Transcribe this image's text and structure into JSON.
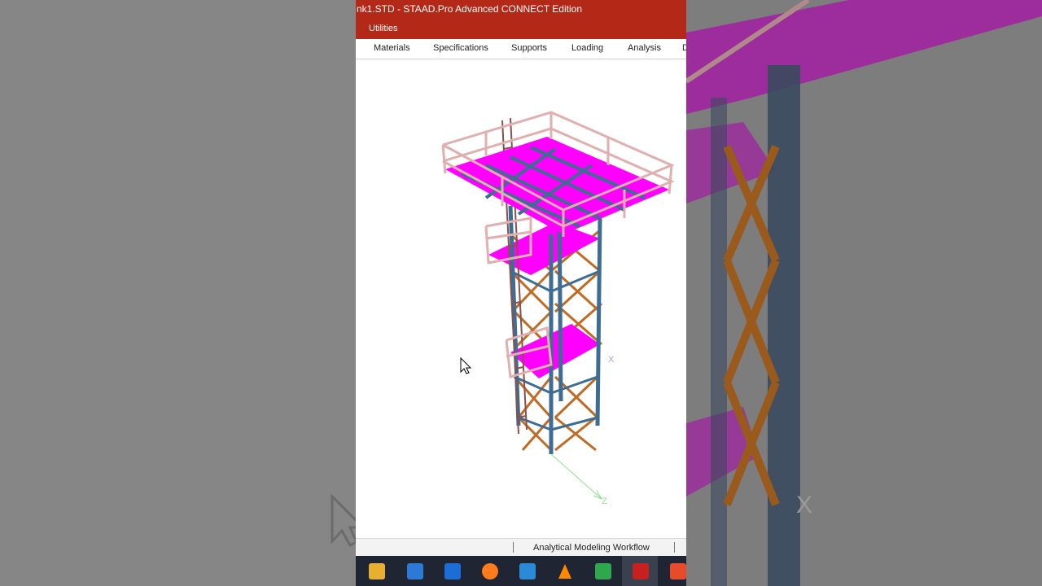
{
  "window": {
    "title": "nk1.STD - STAAD.Pro Advanced CONNECT Edition",
    "menu_item": "Utilities"
  },
  "ribbon": {
    "tabs": [
      "Materials",
      "Specifications",
      "Supports",
      "Loading",
      "Analysis",
      "D"
    ]
  },
  "viewport": {
    "axis_x_label": "X",
    "axis_z_label": "Z"
  },
  "status_bar": {
    "workflow": "Analytical Modeling Workflow"
  },
  "taskbar": {
    "icons": [
      "file-explorer-icon",
      "microsoft-store-icon",
      "mail-icon",
      "firefox-icon",
      "photos-icon",
      "vlc-icon",
      "camtasia-icon",
      "staad-pro-icon",
      "red-app-icon"
    ]
  },
  "colors": {
    "title_bar": "#b42818",
    "deck_plates": "#ff00ff",
    "columns": "#3e6d93",
    "bracing": "#c06a22",
    "railings": "#e0b0b0"
  }
}
